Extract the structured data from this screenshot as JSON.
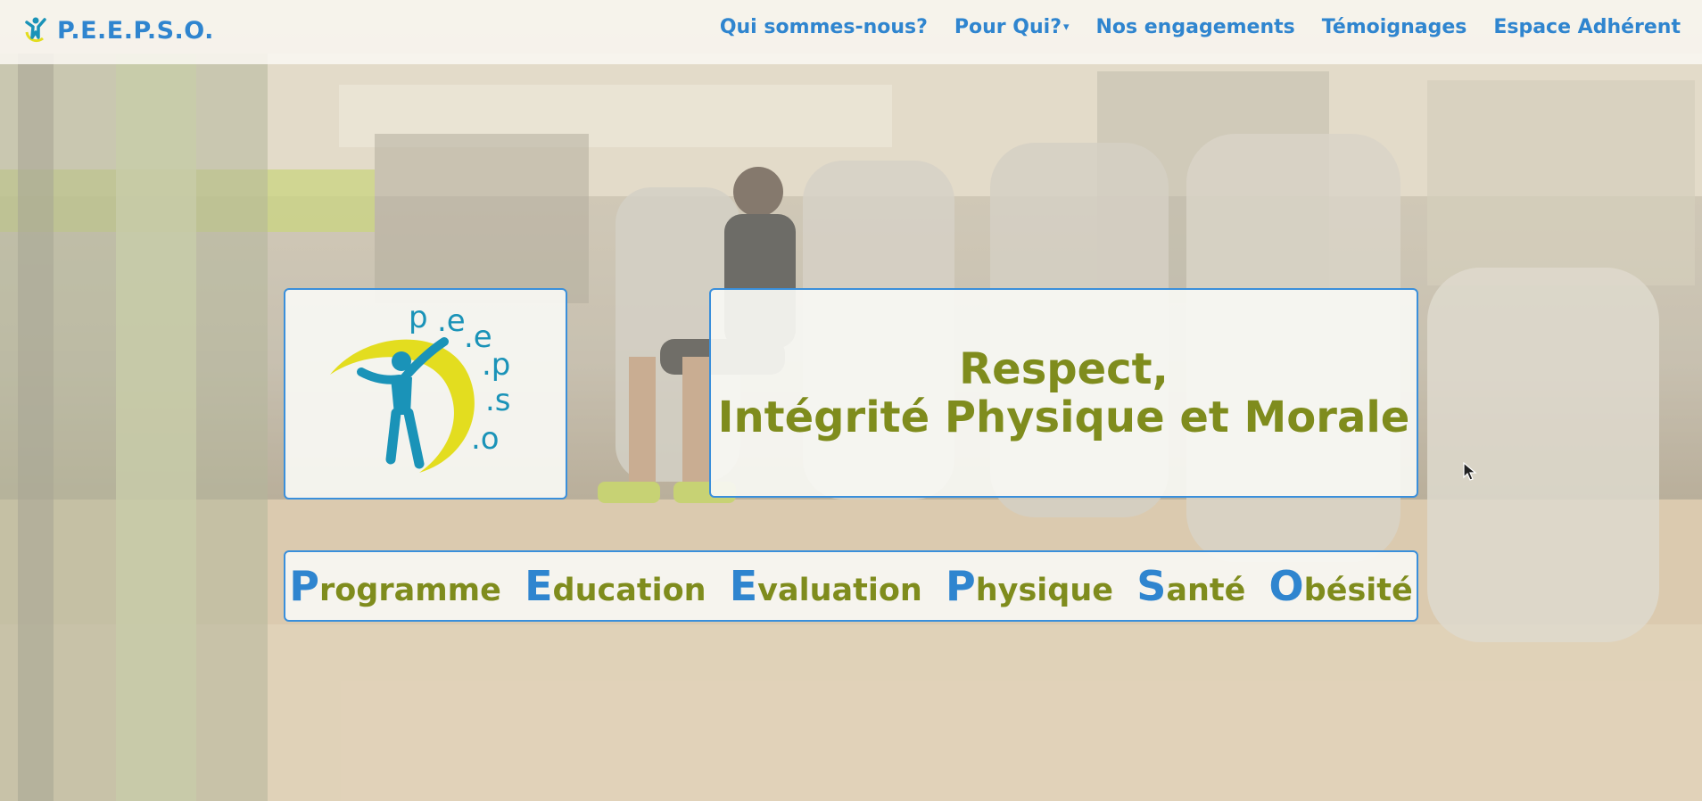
{
  "navbar": {
    "brand": "P.E.E.P.S.O.",
    "links": [
      {
        "label": "Qui sommes-nous?"
      },
      {
        "label": "Pour Qui?",
        "dropdown_caret": "▾"
      },
      {
        "label": "Nos engagements"
      },
      {
        "label": "Témoignages"
      },
      {
        "label": "Espace Adhérent"
      }
    ]
  },
  "hero": {
    "logo": {
      "text": "p.e.e.p.s.o",
      "icon": "peepso-logo-icon"
    },
    "slogan": {
      "line1": "Respect,",
      "line2": "Intégrité Physique et Morale"
    },
    "acronym": [
      {
        "cap": "P",
        "rest": "rogramme"
      },
      {
        "cap": "E",
        "rest": "ducation"
      },
      {
        "cap": "E",
        "rest": "valuation"
      },
      {
        "cap": "P",
        "rest": "hysique"
      },
      {
        "cap": "S",
        "rest": "anté"
      },
      {
        "cap": "O",
        "rest": "bésité"
      }
    ]
  },
  "colors": {
    "brand_blue": "#2f85cf",
    "olive": "#7f8c1d",
    "logo_yellow": "#e3dd1f",
    "logo_teal": "#1a93b8"
  }
}
